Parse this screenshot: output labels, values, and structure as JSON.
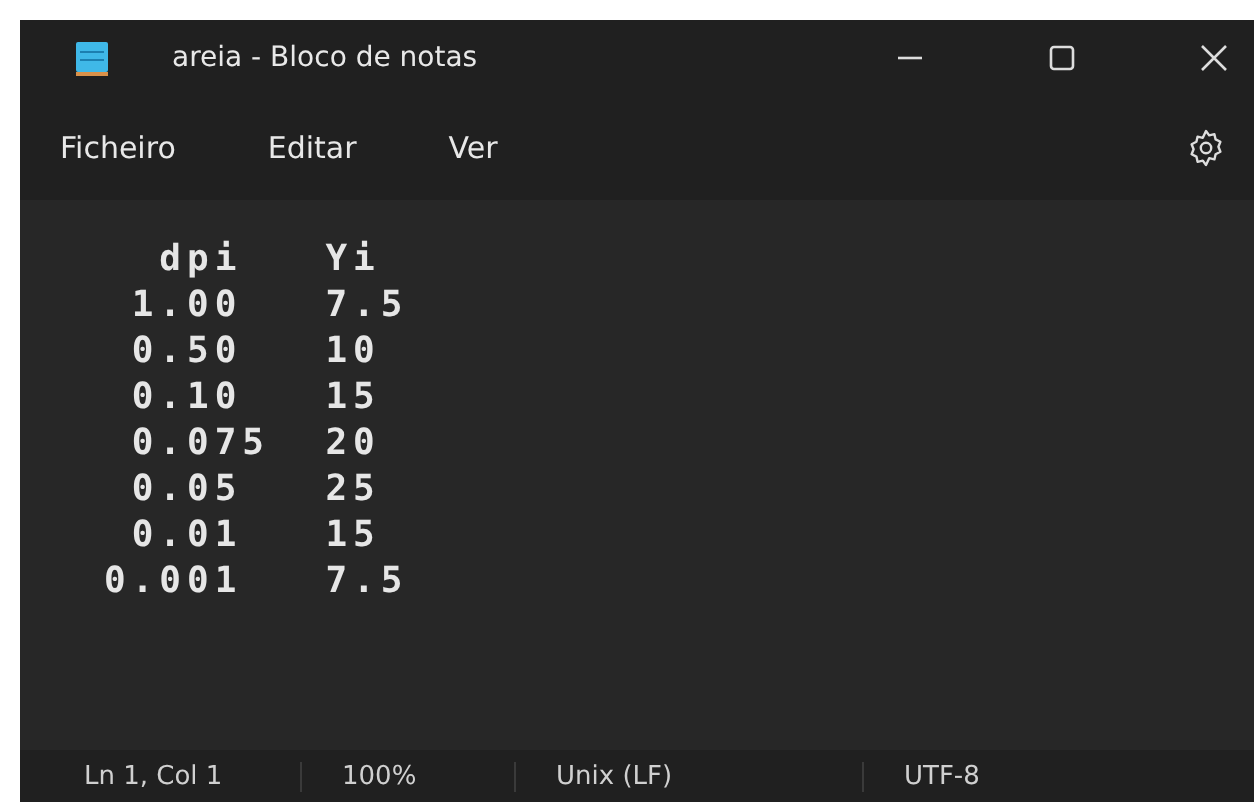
{
  "window": {
    "title": "areia - Bloco de notas"
  },
  "menu": [
    "Ficheiro",
    "Editar",
    "Ver"
  ],
  "editor": {
    "lines": [
      "  dpi   Yi",
      " 1.00   7.5",
      " 0.50   10",
      " 0.10   15",
      " 0.075  20",
      " 0.05   25",
      " 0.01   15",
      "0.001   7.5"
    ]
  },
  "status_bar": [
    "Ln 1, Col 1",
    "100%",
    "Unix (LF)",
    "UTF-8"
  ]
}
